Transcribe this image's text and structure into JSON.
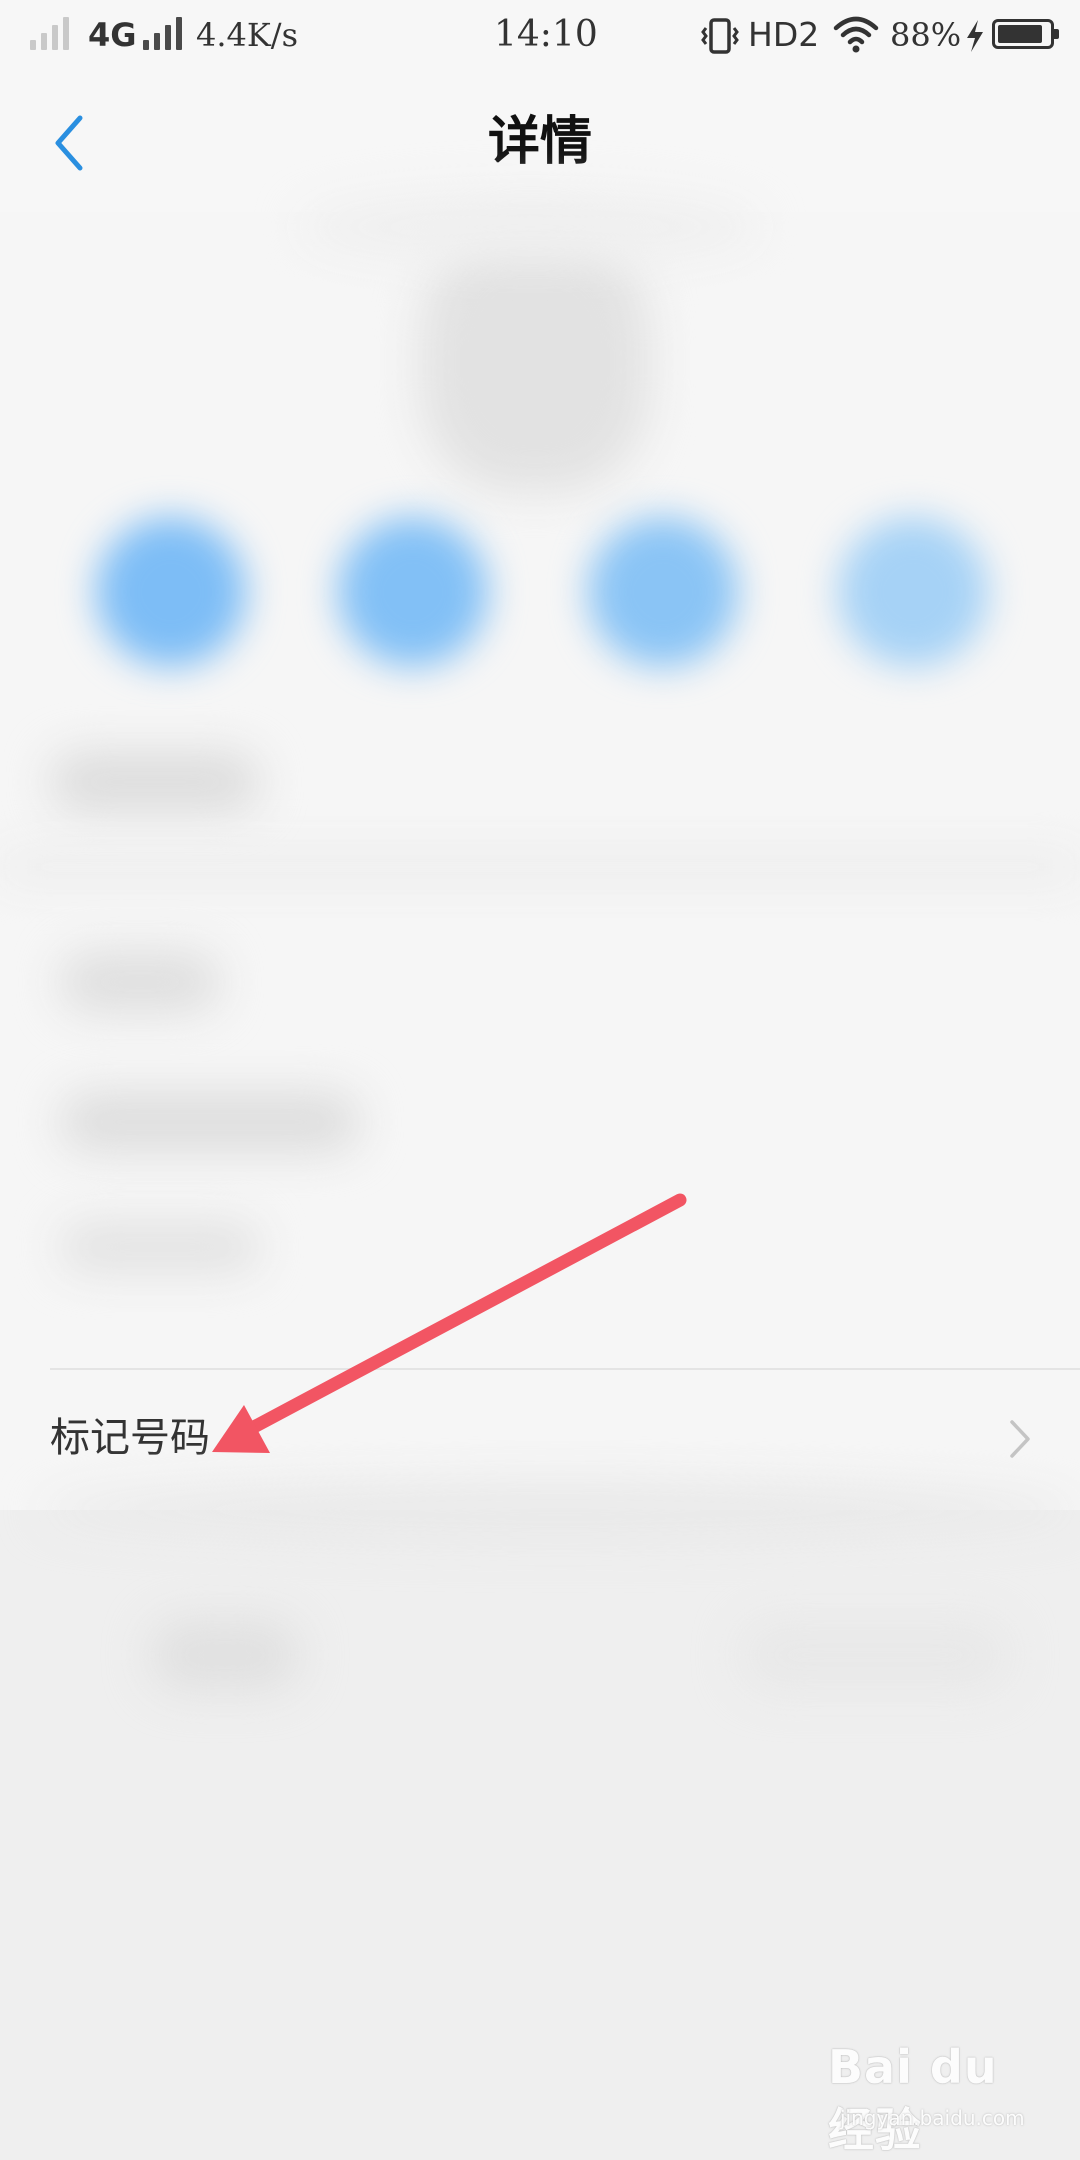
{
  "status_bar": {
    "network_type": "4G",
    "speed": "4.4K/s",
    "time": "14:10",
    "hd_label": "HD2",
    "battery_percent_text": "88%",
    "battery_level": 0.88
  },
  "header": {
    "title": "详情",
    "accent_color": "#2a8fe0"
  },
  "content": {
    "action_colors": [
      "#7dbdf6",
      "#82c0f6",
      "#8ac4f5",
      "#a6d2f6"
    ]
  },
  "mark_row": {
    "label": "标记号码"
  },
  "annotation": {
    "arrow_color": "#f25563"
  },
  "watermark": {
    "logo_text": "Bai du 经验",
    "url_text": "jingyan.baidu.com"
  }
}
